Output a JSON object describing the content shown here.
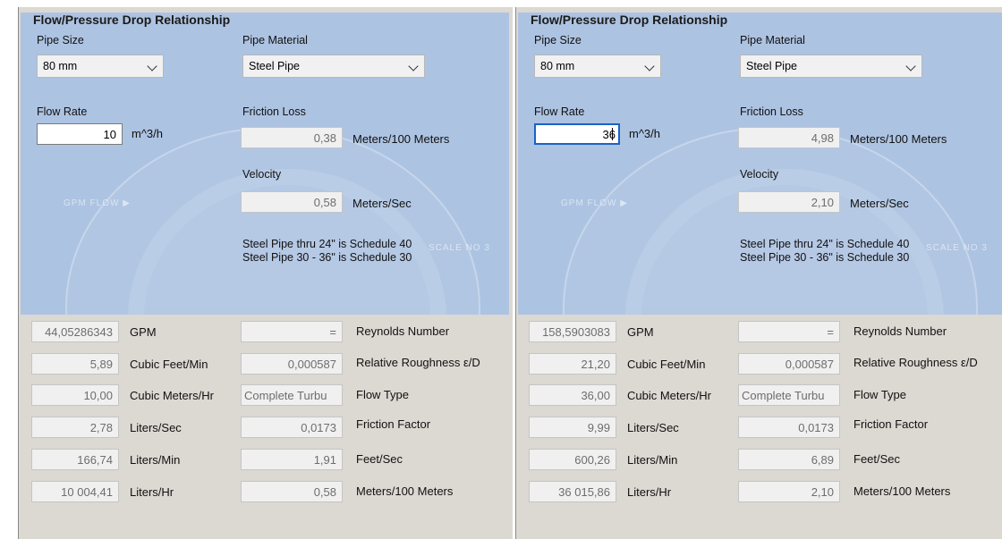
{
  "panels": [
    {
      "title": "Flow/Pressure Drop Relationship",
      "pipe_size": {
        "label": "Pipe Size",
        "value": "80 mm"
      },
      "pipe_material": {
        "label": "Pipe Material",
        "value": "Steel Pipe"
      },
      "flow_rate": {
        "label": "Flow Rate",
        "value": "10",
        "unit": "m^3/h"
      },
      "friction_loss": {
        "label": "Friction Loss",
        "value": "0,38",
        "unit": "Meters/100 Meters"
      },
      "velocity": {
        "label": "Velocity",
        "value": "0,58",
        "unit": "Meters/Sec"
      },
      "dial": {
        "flow_mark": "GPM FLOW ▶",
        "scale": "SCALE NO 3"
      },
      "notes": [
        "Steel Pipe thru 24\" is Schedule 40",
        "Steel Pipe 30 - 36\" is Schedule 30"
      ],
      "results_left": [
        {
          "value": "44,05286343",
          "label": "GPM"
        },
        {
          "value": "5,89",
          "label": "Cubic Feet/Min"
        },
        {
          "value": "10,00",
          "label": "Cubic Meters/Hr"
        },
        {
          "value": "2,78",
          "label": "Liters/Sec"
        },
        {
          "value": "166,74",
          "label": "Liters/Min"
        },
        {
          "value": "10 004,41",
          "label": "Liters/Hr"
        }
      ],
      "results_right": [
        {
          "value": "=",
          "label": "Reynolds Number"
        },
        {
          "value": "0,000587",
          "label": "Relative Roughness ε/D"
        },
        {
          "value": "Complete Turbu",
          "label": "Flow Type"
        },
        {
          "value": "0,0173",
          "label": "Friction Factor"
        },
        {
          "value": "1,91",
          "label": "Feet/Sec"
        },
        {
          "value": "0,58",
          "label": "Meters/100 Meters"
        }
      ]
    },
    {
      "title": "Flow/Pressure Drop Relationship",
      "pipe_size": {
        "label": "Pipe Size",
        "value": "80 mm"
      },
      "pipe_material": {
        "label": "Pipe Material",
        "value": "Steel Pipe"
      },
      "flow_rate": {
        "label": "Flow Rate",
        "value": "36",
        "unit": "m^3/h"
      },
      "friction_loss": {
        "label": "Friction Loss",
        "value": "4,98",
        "unit": "Meters/100 Meters"
      },
      "velocity": {
        "label": "Velocity",
        "value": "2,10",
        "unit": "Meters/Sec"
      },
      "dial": {
        "flow_mark": "GPM FLOW ▶",
        "scale": "SCALE NO 3"
      },
      "notes": [
        "Steel Pipe thru 24\" is Schedule 40",
        "Steel Pipe 30 - 36\" is Schedule 30"
      ],
      "results_left": [
        {
          "value": "158,5903083",
          "label": "GPM"
        },
        {
          "value": "21,20",
          "label": "Cubic Feet/Min"
        },
        {
          "value": "36,00",
          "label": "Cubic Meters/Hr"
        },
        {
          "value": "9,99",
          "label": "Liters/Sec"
        },
        {
          "value": "600,26",
          "label": "Liters/Min"
        },
        {
          "value": "36 015,86",
          "label": "Liters/Hr"
        }
      ],
      "results_right": [
        {
          "value": "=",
          "label": "Reynolds Number"
        },
        {
          "value": "0,000587",
          "label": "Relative Roughness ε/D"
        },
        {
          "value": "Complete Turbu",
          "label": "Flow Type"
        },
        {
          "value": "0,0173",
          "label": "Friction Factor"
        },
        {
          "value": "6,89",
          "label": "Feet/Sec"
        },
        {
          "value": "2,10",
          "label": "Meters/100 Meters"
        }
      ]
    }
  ],
  "colors": {
    "blue_area": "#adc3e2",
    "panel_bg": "#dcd8d2",
    "focus_border": "#1a62c7"
  }
}
